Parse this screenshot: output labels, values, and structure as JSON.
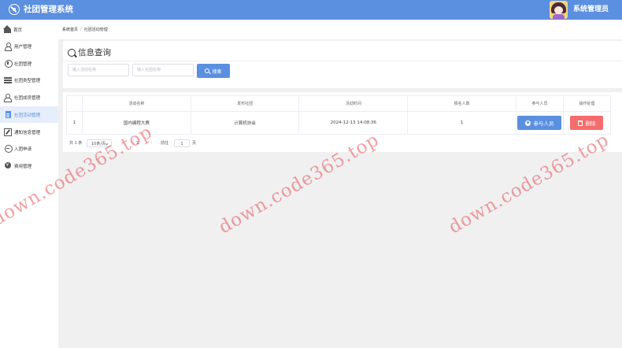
{
  "header": {
    "app_title": "社团管理系统",
    "user_name": "系统管理员"
  },
  "sidebar": {
    "items": [
      {
        "label": "首页",
        "icon": "home-icon",
        "active": false
      },
      {
        "label": "用户管理",
        "icon": "user-icon",
        "active": false
      },
      {
        "label": "社团管理",
        "icon": "club-icon",
        "active": false
      },
      {
        "label": "社团类型管理",
        "icon": "list-icon",
        "active": false
      },
      {
        "label": "社团成员管理",
        "icon": "members-icon",
        "active": false
      },
      {
        "label": "社团活动管理",
        "icon": "document-icon",
        "active": true
      },
      {
        "label": "通知信息管理",
        "icon": "edit-icon",
        "active": false
      },
      {
        "label": "入团申请",
        "icon": "apply-icon",
        "active": false
      },
      {
        "label": "费用管理",
        "icon": "money-icon",
        "active": false
      }
    ]
  },
  "breadcrumb": {
    "home": "系统首页",
    "separator": "/",
    "current": "社团活动管理"
  },
  "search": {
    "title": "信息查询",
    "activity_placeholder": "输入活动名称",
    "club_placeholder": "输入社团名称",
    "button_label": "搜索"
  },
  "table": {
    "columns": [
      "",
      "活动名称",
      "发布社团",
      "活动时间",
      "报名人数",
      "参与人员",
      "操作处理"
    ],
    "rows": [
      {
        "index": "1",
        "name": "国内编程大赛",
        "club": "计算机协会",
        "time": "2024-12-13 14:08:36",
        "signups": "1",
        "participants_label": "参与人员",
        "delete_label": "删除"
      }
    ]
  },
  "pagination": {
    "total": "共 1 条",
    "page_size": "10条/页",
    "prev": "‹",
    "current_page": "1",
    "next": "›",
    "goto_label": "前往",
    "goto_value": "1",
    "unit": "页"
  },
  "watermark": "down.code365.top",
  "colors": {
    "primary": "#5b8fe0",
    "danger": "#f56c6c",
    "active_menu_bg": "#e6eefb"
  }
}
